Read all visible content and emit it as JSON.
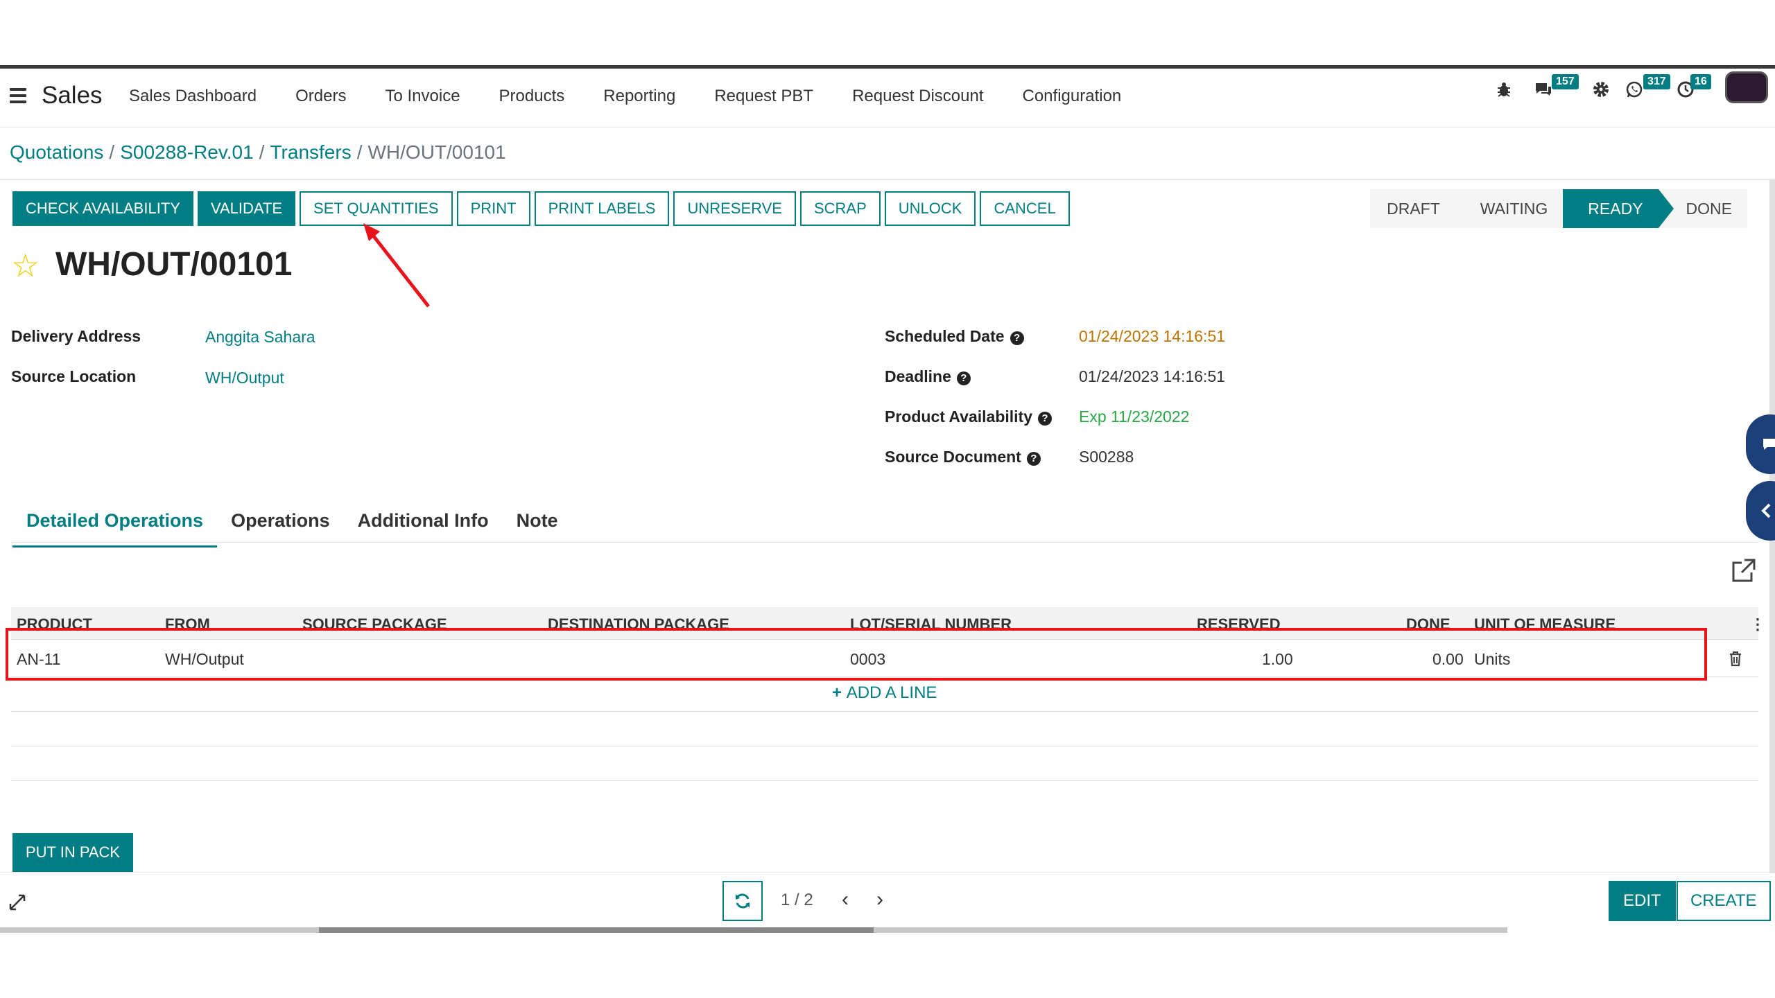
{
  "navbar": {
    "app_name": "Sales",
    "menu": [
      "Sales Dashboard",
      "Orders",
      "To Invoice",
      "Products",
      "Reporting",
      "Request PBT",
      "Request Discount",
      "Configuration"
    ],
    "badges": {
      "messages": "157",
      "activities": "317",
      "other": "16"
    }
  },
  "breadcrumb": {
    "items": [
      "Quotations",
      "S00288-Rev.01",
      "Transfers"
    ],
    "current": "WH/OUT/00101"
  },
  "actions": {
    "check_availability": "CHECK AVAILABILITY",
    "validate": "VALIDATE",
    "set_quantities": "SET QUANTITIES",
    "print": "PRINT",
    "print_labels": "PRINT LABELS",
    "unreserve": "UNRESERVE",
    "scrap": "SCRAP",
    "unlock": "UNLOCK",
    "cancel": "CANCEL"
  },
  "status": {
    "stages": [
      "DRAFT",
      "WAITING",
      "READY",
      "DONE"
    ],
    "current": "READY"
  },
  "record": {
    "title": "WH/OUT/00101",
    "fields": {
      "delivery_address_label": "Delivery Address",
      "delivery_address": "Anggita Sahara",
      "source_location_label": "Source Location",
      "source_location": "WH/Output",
      "scheduled_date_label": "Scheduled Date",
      "scheduled_date": "01/24/2023 14:16:51",
      "deadline_label": "Deadline",
      "deadline": "01/24/2023 14:16:51",
      "product_availability_label": "Product Availability",
      "product_availability": "Exp 11/23/2022",
      "source_document_label": "Source Document",
      "source_document": "S00288"
    }
  },
  "tabs": [
    "Detailed Operations",
    "Operations",
    "Additional Info",
    "Note"
  ],
  "table": {
    "headers": [
      "PRODUCT",
      "FROM",
      "SOURCE PACKAGE",
      "DESTINATION PACKAGE",
      "LOT/SERIAL NUMBER",
      "RESERVED",
      "DONE",
      "UNIT OF MEASURE"
    ],
    "rows": [
      {
        "product": "AN-11",
        "from": "WH/Output",
        "source_package": "",
        "destination_package": "",
        "lot": "0003",
        "reserved": "1.00",
        "done": "0.00",
        "uom": "Units"
      }
    ],
    "add_line": "ADD A LINE"
  },
  "put_in_pack": "PUT IN PACK",
  "footer": {
    "pager": "1 / 2",
    "edit": "EDIT",
    "create": "CREATE"
  },
  "colors": {
    "primary": "#017e84",
    "link": "#017e84",
    "annotation": "#e8141c",
    "date_warning": "#c07400",
    "success": "#28a745"
  }
}
